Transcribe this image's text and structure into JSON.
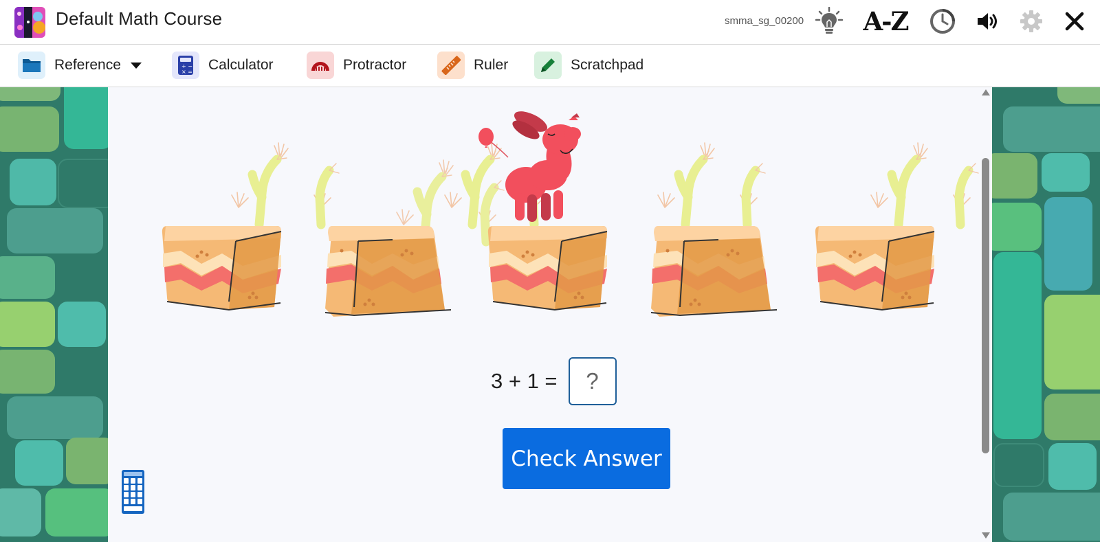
{
  "header": {
    "title": "Default Math Course",
    "session_id": "smma_sg_00200",
    "icons": [
      "hint-lightbulb-icon",
      "glossary-az-icon",
      "timer-icon",
      "sound-icon",
      "settings-gear-icon",
      "close-icon"
    ],
    "glossary_label": "A-Z"
  },
  "toolbar": {
    "reference": "Reference",
    "calculator": "Calculator",
    "protractor": "Protractor",
    "ruler": "Ruler",
    "scratchpad": "Scratchpad"
  },
  "problem": {
    "equation": "3 + 1 =",
    "answer_placeholder": "?",
    "check_button": "Check Answer",
    "rock_count": 5,
    "dog_on_rock": 3
  },
  "colors": {
    "primary_button": "#0a6ce0",
    "answer_border": "#1f5f99",
    "panel_bg": "#f7f8fc",
    "side_bg": "#2f7a69"
  }
}
